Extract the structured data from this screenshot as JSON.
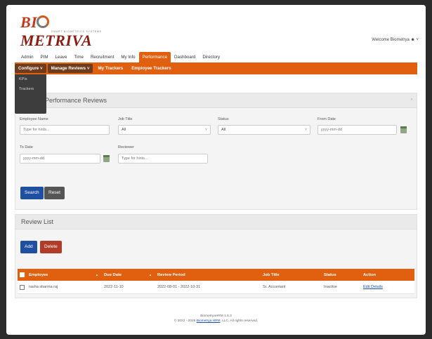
{
  "brand": {
    "logo_text_a": "BI",
    "logo_text_b": "METRIVA",
    "tagline": "SMART BIOMETRICS SYSTEMS"
  },
  "header": {
    "welcome": "Welcome Biometrya"
  },
  "main_nav": [
    "Admin",
    "PIM",
    "Leave",
    "Time",
    "Recruitment",
    "My Info",
    "Performance",
    "Dashboard",
    "Directory"
  ],
  "active_main": "Performance",
  "sub_nav": {
    "configure": "Configure",
    "manage_reviews": "Manage Reviews",
    "my_trackers": "My Trackers",
    "employee_trackers": "Employee Trackers"
  },
  "configure_menu": [
    "KPIs",
    "Trackers"
  ],
  "search_panel": {
    "title": "Performance Reviews",
    "employee_name": {
      "label": "Employee Name",
      "placeholder": "Type for hints..."
    },
    "job_title": {
      "label": "Job Title",
      "value": "All"
    },
    "status": {
      "label": "Status",
      "value": "All"
    },
    "from_date": {
      "label": "From Date",
      "placeholder": "yyyy-mm-dd"
    },
    "to_date": {
      "label": "To Date",
      "placeholder": "yyyy-mm-dd"
    },
    "reviewer": {
      "label": "Reviewer",
      "placeholder": "Type for hints..."
    },
    "search_label": "Search",
    "reset_label": "Reset"
  },
  "review_list": {
    "title": "Review List",
    "add_label": "Add",
    "delete_label": "Delete",
    "columns": [
      "Employee",
      "Due Date",
      "Review Period",
      "Job Title",
      "Status",
      "Action"
    ],
    "rows": [
      {
        "employee": "rasha sharma raj",
        "due_date": "2022-11-10",
        "review_period": "2022-08-01 - 2022-10-31",
        "job_title": "Sr. Accontant",
        "status": "Inactive",
        "action": "Edit Details"
      }
    ]
  },
  "footer": {
    "line1": "BiometryaHRM 1.5.3",
    "line2_pre": "© 2022 - 2026",
    "line2_link": "Biometrya HRM",
    "line2_post": ", LLC. All rights reserved."
  },
  "colors": {
    "accent": "#e0600f",
    "primary_button": "#1e4fa1",
    "danger_button": "#b03c2a"
  }
}
